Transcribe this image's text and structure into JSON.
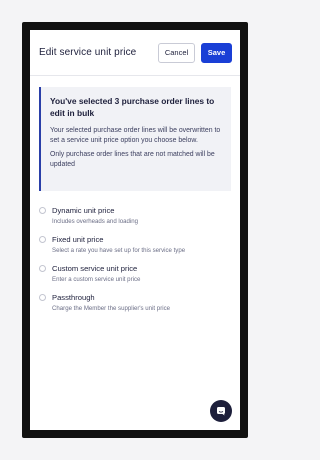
{
  "header": {
    "title": "Edit service unit price",
    "cancel_label": "Cancel",
    "save_label": "Save"
  },
  "notice": {
    "title": "You've selected 3 purchase order lines to edit in bulk",
    "body": "Your selected purchase order lines will be overwritten to set a service unit price option you choose below.",
    "body2": "Only purchase order lines that are not matched will be updated"
  },
  "options": [
    {
      "label": "Dynamic unit price",
      "description": "Includes overheads and loading"
    },
    {
      "label": "Fixed unit price",
      "description": "Select a rate you have set up for this service type"
    },
    {
      "label": "Custom service unit price",
      "description": "Enter a custom service unit price"
    },
    {
      "label": "Passthrough",
      "description": "Charge the Member the supplier's unit price"
    }
  ],
  "chat": {
    "icon": "chat-icon"
  },
  "colors": {
    "accent": "#1a3fd6",
    "notice_border": "#2a3fa8",
    "notice_bg": "#f1f2f6",
    "text": "#1d1f3b"
  }
}
